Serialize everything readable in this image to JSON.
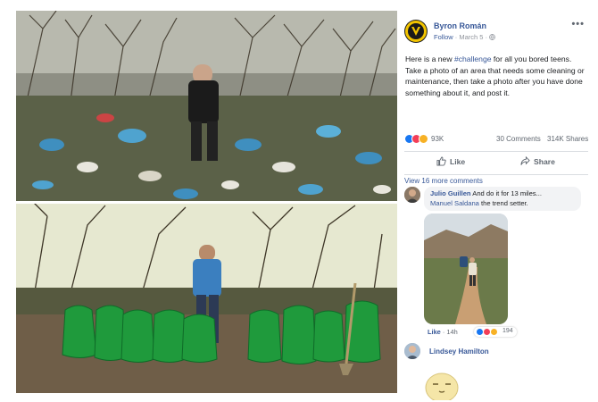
{
  "post": {
    "author": "Byron Román",
    "follow_label": "Follow",
    "date": "March 5",
    "more_label": "•••",
    "text_before_tag": "Here is a new ",
    "hashtag": "#challenge",
    "text_after_tag": " for all you bored teens. Take a photo of an area that needs some cleaning or maintenance, then take a photo after you have done something about it, and post it.",
    "reaction_count": "93K",
    "comments_count": "30 Comments",
    "shares_count": "314K Shares",
    "like_label": "Like",
    "share_label": "Share"
  },
  "comments": {
    "view_more": "View 16 more comments",
    "first": {
      "name": "Julio Guillen",
      "text": " And do it for 13 miles...",
      "mention": "Manuel Saldana",
      "mention_suffix": " the trend setter."
    },
    "reply_meta": {
      "like_label": "Like",
      "separator": " · ",
      "time": "14h",
      "reaction_count": "194"
    },
    "second": {
      "name": "Lindsey Hamilton"
    }
  },
  "colors": {
    "link_blue": "#385898",
    "bag_green": "#1f9a3c",
    "litter_blue": "#3f8fbf"
  },
  "icons": [
    "globe-icon",
    "more-icon",
    "like-icon",
    "share-icon",
    "like-reaction-icon",
    "love-reaction-icon",
    "wow-reaction-icon",
    "haha-reaction-icon",
    "sticker-icon"
  ]
}
